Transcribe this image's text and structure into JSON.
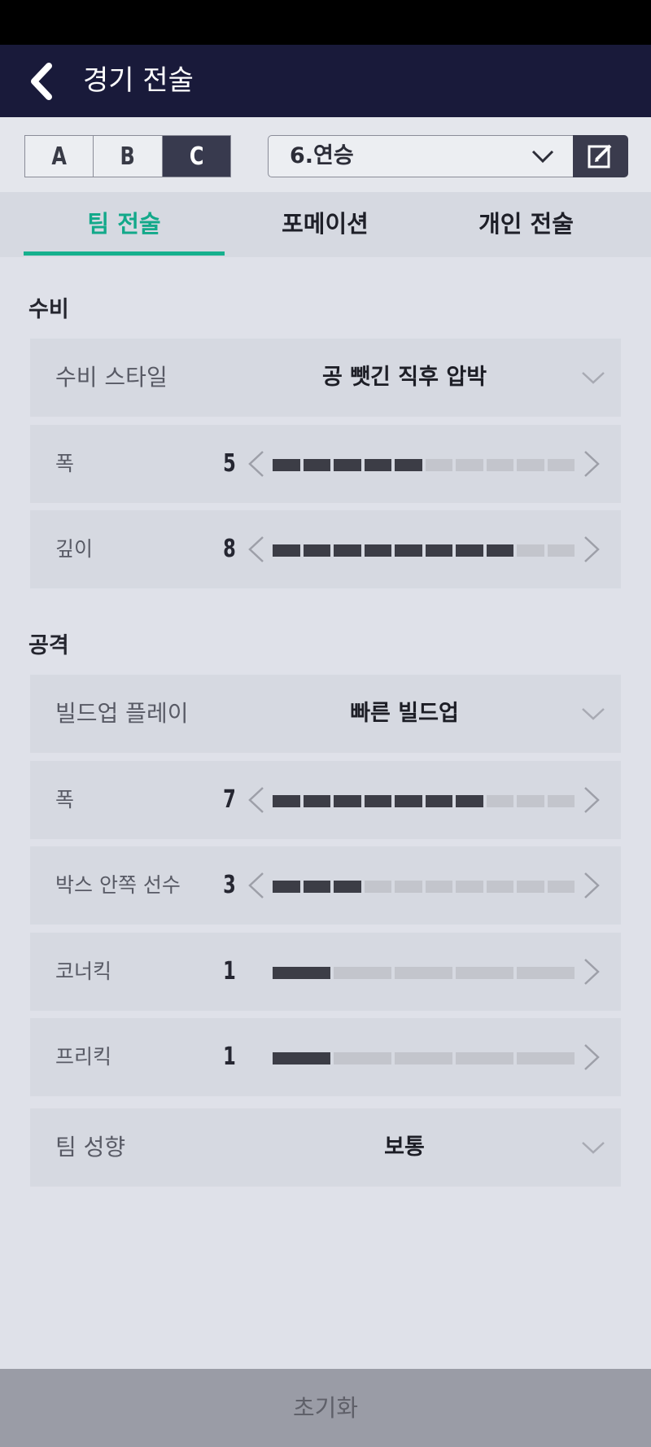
{
  "header": {
    "title": "경기 전술"
  },
  "squad_tabs": [
    {
      "label": "A",
      "active": false
    },
    {
      "label": "B",
      "active": false
    },
    {
      "label": "C",
      "active": true
    }
  ],
  "tactic_select": {
    "value": "6.연승"
  },
  "main_tabs": [
    {
      "label": "팀 전술",
      "active": true
    },
    {
      "label": "포메이션",
      "active": false
    },
    {
      "label": "개인 전술",
      "active": false
    }
  ],
  "defense": {
    "title": "수비",
    "style": {
      "label": "수비 스타일",
      "value": "공 뺏긴 직후 압박"
    },
    "width": {
      "label": "폭",
      "value": "5",
      "level": 5,
      "max": 10
    },
    "depth": {
      "label": "깊이",
      "value": "8",
      "level": 8,
      "max": 10
    }
  },
  "attack": {
    "title": "공격",
    "buildup": {
      "label": "빌드업 플레이",
      "value": "빠른 빌드업"
    },
    "width": {
      "label": "폭",
      "value": "7",
      "level": 7,
      "max": 10
    },
    "box_players": {
      "label": "박스 안쪽 선수",
      "value": "3",
      "level": 3,
      "max": 10
    },
    "corner_kick": {
      "label": "코너킥",
      "value": "1",
      "level": 1,
      "max": 5
    },
    "free_kick": {
      "label": "프리킥",
      "value": "1",
      "level": 1,
      "max": 5
    },
    "team_tendency": {
      "label": "팀 성향",
      "value": "보통"
    }
  },
  "footer": {
    "reset_label": "초기화"
  },
  "colors": {
    "accent": "#16b08e",
    "header_bg": "#191a3a",
    "bar_on": "#3c3d46",
    "bar_off": "#c3c5cc"
  }
}
